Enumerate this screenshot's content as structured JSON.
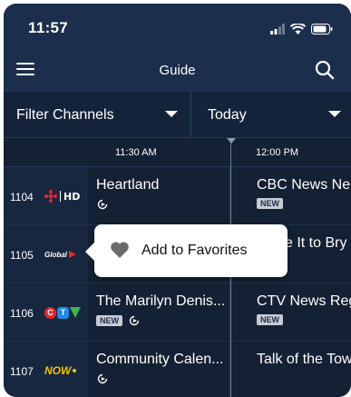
{
  "status_bar": {
    "time": "11:57"
  },
  "header": {
    "title": "Guide"
  },
  "filters": {
    "channels_label": "Filter Channels",
    "day_label": "Today"
  },
  "timeline": {
    "slot_1": "11:30 AM",
    "slot_2": "12:00 PM"
  },
  "rows": [
    {
      "channel_number": "1104",
      "logo": "CBC HD",
      "programs": [
        {
          "title": "Heartland",
          "new": false,
          "replay": true
        },
        {
          "title": "CBC News Ne",
          "new": true,
          "replay": false
        }
      ]
    },
    {
      "channel_number": "1105",
      "logo": "Global",
      "programs": [
        {
          "title": "",
          "new": false,
          "replay": false
        },
        {
          "title": "e It to Bry",
          "new": false,
          "replay": false
        }
      ]
    },
    {
      "channel_number": "1106",
      "logo": "CTV",
      "programs": [
        {
          "title": "The Marilyn Denis...",
          "new": true,
          "replay": true
        },
        {
          "title": "CTV News Reg",
          "new": true,
          "replay": false
        }
      ]
    },
    {
      "channel_number": "1107",
      "logo": "NOW",
      "programs": [
        {
          "title": "Community Calen...",
          "new": false,
          "replay": true
        },
        {
          "title": "Talk of the Tow",
          "new": false,
          "replay": false
        }
      ]
    }
  ],
  "badges": {
    "new_label": "NEW"
  },
  "tooltip": {
    "label": "Add to Favorites"
  },
  "colors": {
    "header_bg": "#1b2e4b",
    "grid_bg": "#142033",
    "accent_red": "#e4262c"
  }
}
